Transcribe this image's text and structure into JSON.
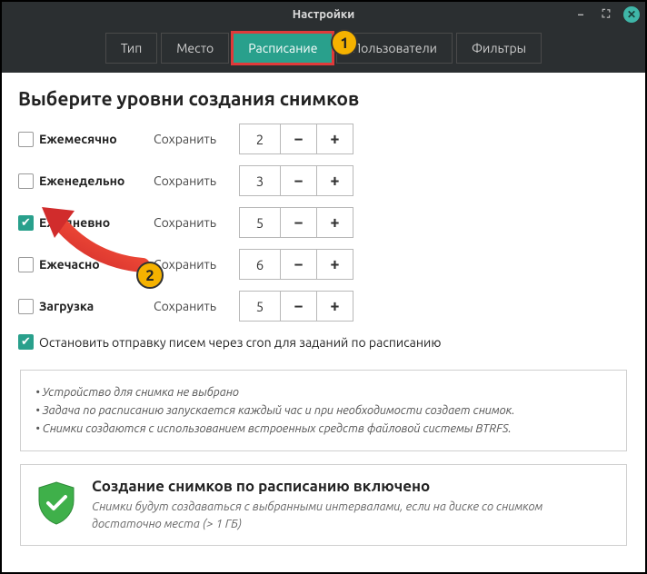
{
  "window": {
    "title": "Настройки"
  },
  "tabs": [
    {
      "label": "Тип",
      "active": false
    },
    {
      "label": "Место",
      "active": false
    },
    {
      "label": "Расписание",
      "active": true,
      "highlight": true
    },
    {
      "label": "Пользователи",
      "active": false
    },
    {
      "label": "Фильтры",
      "active": false
    }
  ],
  "heading": "Выберите уровни создания снимков",
  "keep_label": "Сохранить",
  "levels": [
    {
      "key": "monthly",
      "label": "Ежемесячно",
      "checked": false,
      "value": "2"
    },
    {
      "key": "weekly",
      "label": "Еженедельно",
      "checked": false,
      "value": "3"
    },
    {
      "key": "daily",
      "label": "Ежедневно",
      "checked": true,
      "value": "5"
    },
    {
      "key": "hourly",
      "label": "Ежечасно",
      "checked": false,
      "value": "6"
    },
    {
      "key": "boot",
      "label": "Загрузка",
      "checked": false,
      "value": "5"
    }
  ],
  "cron": {
    "checked": true,
    "label": "Остановить отправку писем через cron для заданий по расписанию"
  },
  "info": {
    "line1": "• Устройство для снимка не выбрано",
    "line2": "• Задача по расписанию запускается каждый час и при необходимости создает снимок.",
    "line3": "• Снимки создаются с использованием встроенных средств файловой системы BTRFS."
  },
  "status": {
    "title": "Создание снимков по расписанию включено",
    "subtitle": "Снимки будут создаваться с выбранными интервалами, если на диске со снимком достаточно места (> 1 ГБ)"
  },
  "annotations": {
    "marker1": "1",
    "marker2": "2"
  },
  "colors": {
    "accent": "#29a08c",
    "highlight": "#e03a3a",
    "marker_bg": "#f5b200"
  }
}
